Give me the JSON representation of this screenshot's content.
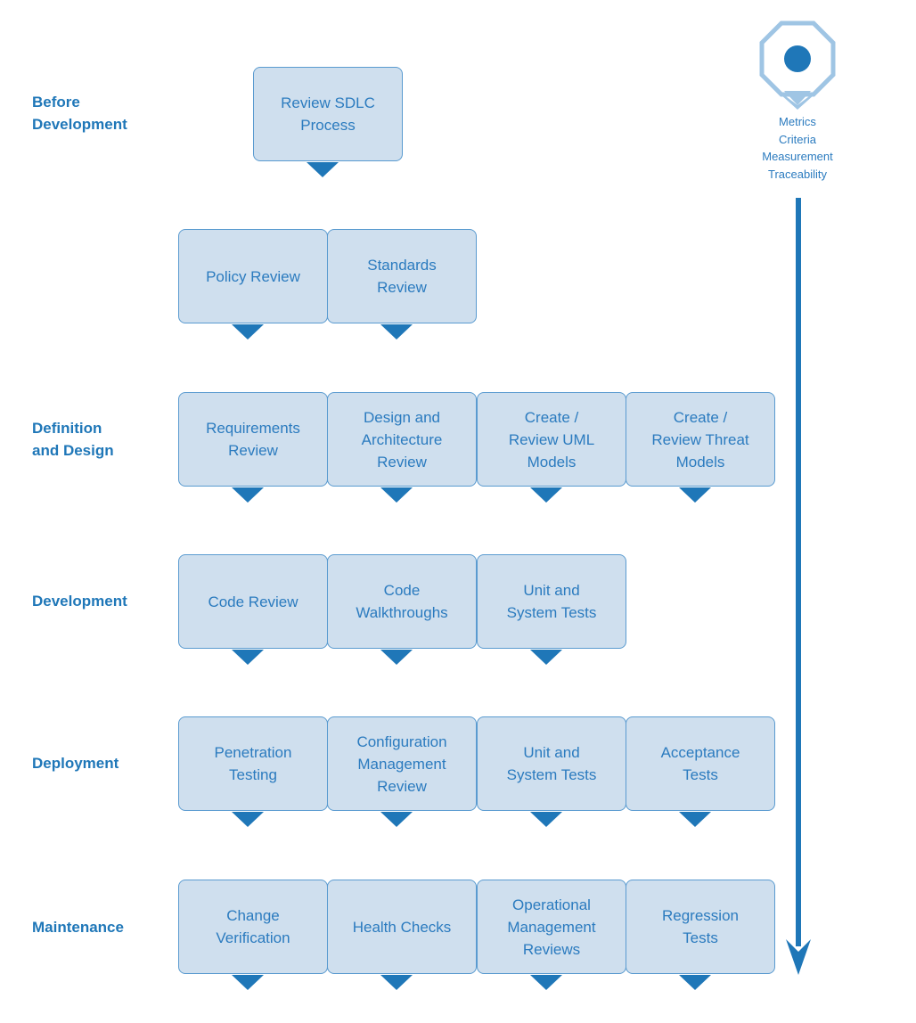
{
  "colors": {
    "box_fill": "#cfdfee",
    "box_border": "#5a9bd0",
    "text": "#2b7bbf",
    "accent": "#1f77b8",
    "legend_light": "#9fc5e4"
  },
  "legend": {
    "icon": "octagon-pin-icon",
    "lines": "Metrics\nCriteria\nMeasurement\nTraceability"
  },
  "flow_arrow": {
    "icon": "down-arrow-icon",
    "direction": "down"
  },
  "phases": [
    {
      "label": "Before\nDevelopment",
      "label_row": 0
    },
    {
      "label": "",
      "label_row": 1
    },
    {
      "label": "Definition\nand Design",
      "label_row": 2
    },
    {
      "label": "Development",
      "label_row": 3
    },
    {
      "label": "Deployment",
      "label_row": 4
    },
    {
      "label": "Maintenance",
      "label_row": 5
    }
  ],
  "rows": [
    {
      "boxes": [
        "Review SDLC\nProcess"
      ]
    },
    {
      "boxes": [
        "Policy Review",
        "Standards\nReview"
      ]
    },
    {
      "boxes": [
        "Requirements\nReview",
        "Design and\nArchitecture\nReview",
        "Create /\nReview UML\nModels",
        "Create /\nReview Threat\nModels"
      ]
    },
    {
      "boxes": [
        "Code Review",
        "Code\nWalkthroughs",
        "Unit and\nSystem Tests"
      ]
    },
    {
      "boxes": [
        "Penetration\nTesting",
        "Configuration\nManagement\nReview",
        "Unit and\nSystem Tests",
        "Acceptance\nTests"
      ]
    },
    {
      "boxes": [
        "Change\nVerification",
        "Health Checks",
        "Operational\nManagement\nReviews",
        "Regression\nTests"
      ]
    }
  ]
}
